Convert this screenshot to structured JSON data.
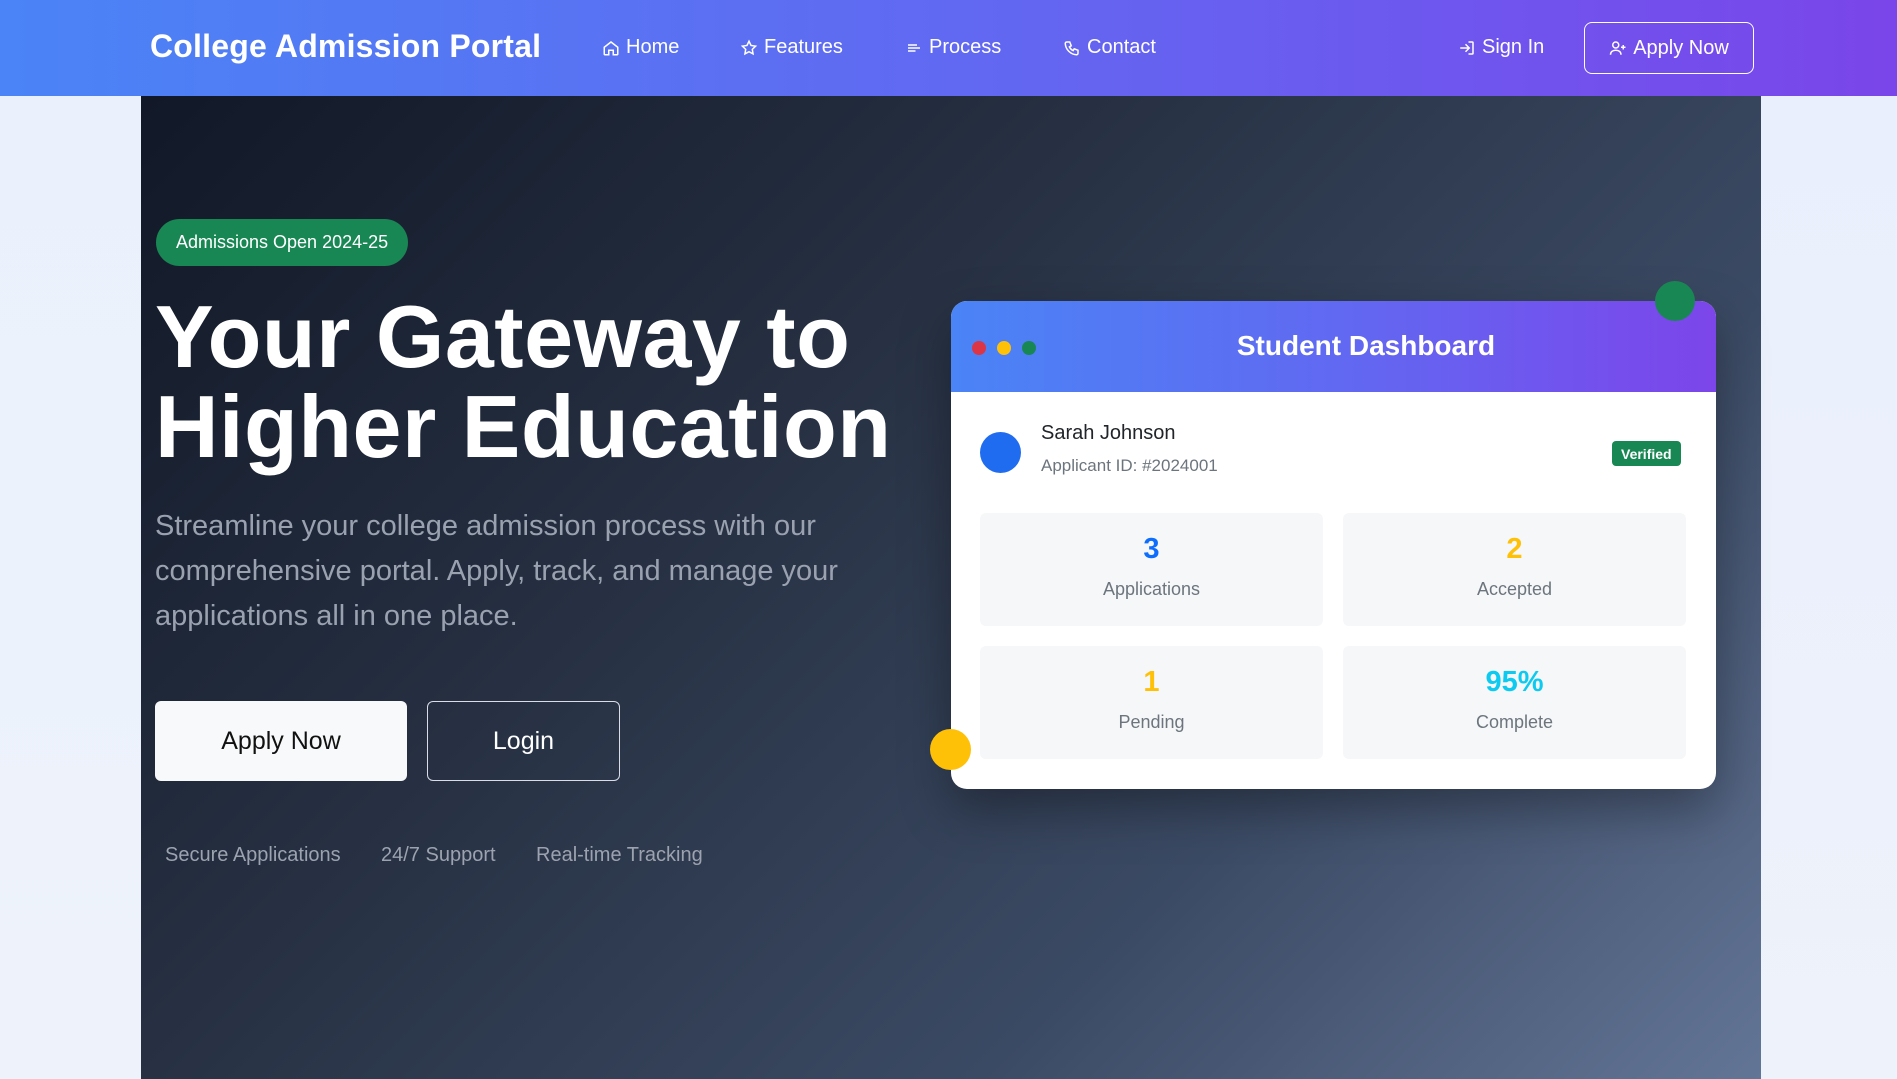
{
  "navbar": {
    "brand": "College Admission Portal",
    "links": [
      {
        "label": "Home",
        "icon": "home-icon"
      },
      {
        "label": "Features",
        "icon": "star-icon"
      },
      {
        "label": "Process",
        "icon": "list-icon"
      },
      {
        "label": "Contact",
        "icon": "phone-icon"
      }
    ],
    "signin_label": "Sign In",
    "apply_label": "Apply Now"
  },
  "hero": {
    "badge": "Admissions Open 2024-25",
    "title_line1": "Your Gateway to",
    "title_line2": "Higher Education",
    "subtitle": "Streamline your college admission process with our comprehensive portal. Apply, track, and manage your applications all in one place.",
    "apply_button": "Apply Now",
    "login_button": "Login",
    "features": [
      "Secure Applications",
      "24/7 Support",
      "Real-time Tracking"
    ]
  },
  "dashboard": {
    "title": "Student Dashboard",
    "user_name": "Sarah Johnson",
    "applicant_id": "Applicant ID: #2024001",
    "verified_label": "Verified",
    "stats": [
      {
        "value": "3",
        "label": "Applications",
        "color": "#0d6efd"
      },
      {
        "value": "2",
        "label": "Accepted",
        "color": "#ffc107"
      },
      {
        "value": "1",
        "label": "Pending",
        "color": "#ffc107"
      },
      {
        "value": "95%",
        "label": "Complete",
        "color": "#0dcaf0"
      }
    ]
  },
  "colors": {
    "brand_gradient_start": "#4a84f6",
    "brand_gradient_end": "#7a45ea",
    "success": "#198754",
    "warning": "#ffc107"
  }
}
